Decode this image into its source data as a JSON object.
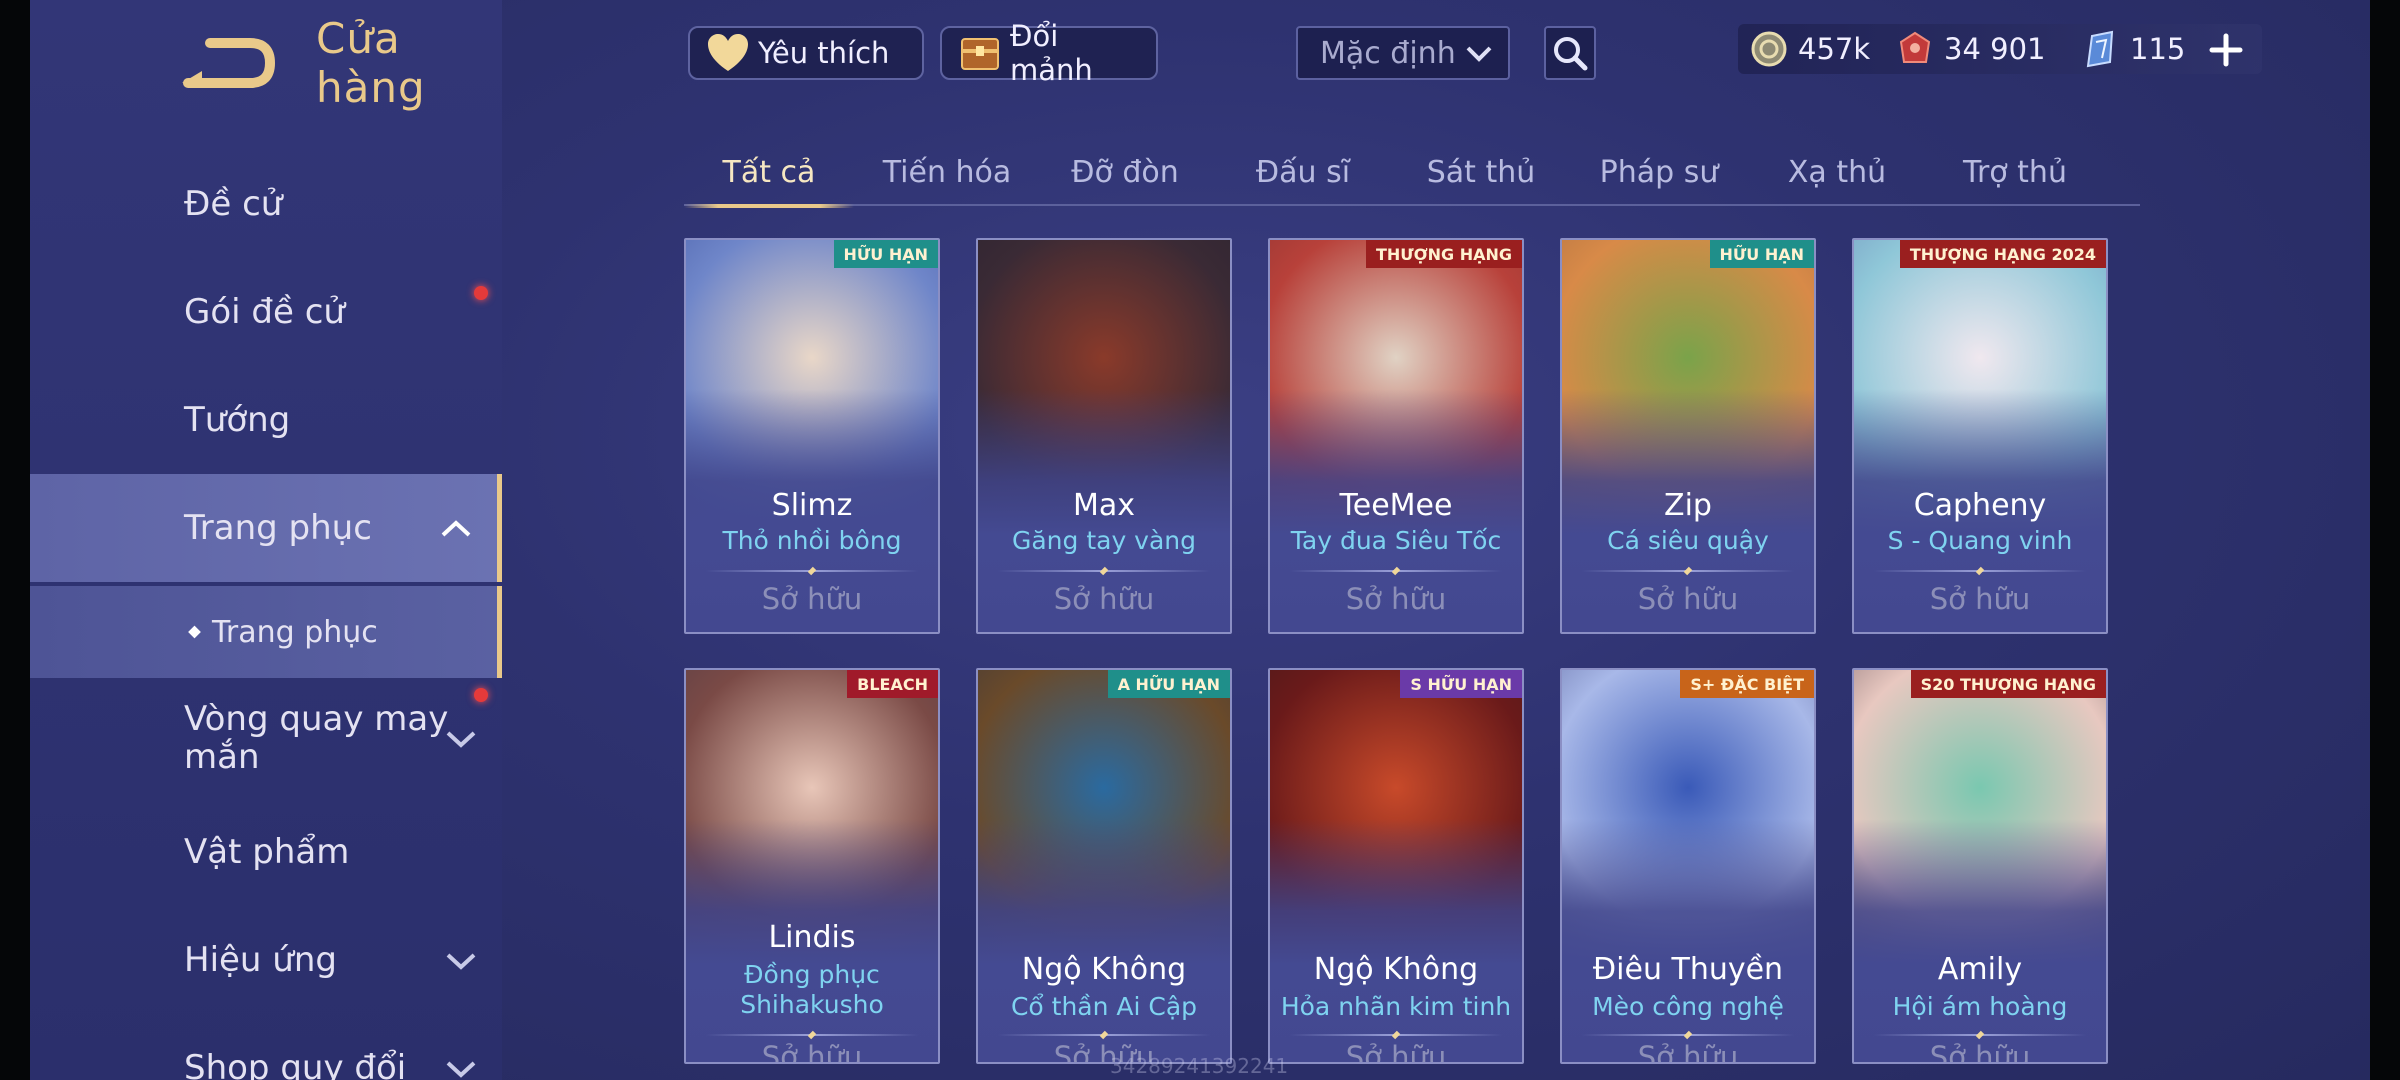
{
  "header": {
    "title": "Cửa hàng"
  },
  "sidebar": {
    "items": [
      {
        "label": "Đề cử",
        "badge": false,
        "chevron": ""
      },
      {
        "label": "Gói đề cử",
        "badge": true,
        "chevron": ""
      },
      {
        "label": "Tướng",
        "badge": false,
        "chevron": ""
      },
      {
        "label": "Trang phục",
        "badge": false,
        "chevron": "up",
        "active": true
      },
      {
        "label": "Trang phục",
        "sub": true
      },
      {
        "label": "Vòng quay may mắn",
        "badge": true,
        "chevron": "down"
      },
      {
        "label": "Vật phẩm",
        "badge": false,
        "chevron": ""
      },
      {
        "label": "Hiệu ứng",
        "badge": false,
        "chevron": "down"
      },
      {
        "label": "Shop quy đổi",
        "badge": false,
        "chevron": "down"
      }
    ]
  },
  "topbar": {
    "favorite_label": "Yêu thích",
    "exchange_label": "Đổi mảnh",
    "sort_value": "Mặc định",
    "currencies": [
      {
        "icon": "gold-coin-icon",
        "value": "457k"
      },
      {
        "icon": "red-voucher-icon",
        "value": "34 901"
      },
      {
        "icon": "blue-crystal-icon",
        "value": "115"
      }
    ]
  },
  "tabs": [
    "Tất cả",
    "Tiến hóa",
    "Đỡ đòn",
    "Đấu sĩ",
    "Sát thủ",
    "Pháp sư",
    "Xạ thủ",
    "Trợ thủ"
  ],
  "cards": [
    {
      "hero": "Slimz",
      "skin": "Thỏ nhồi bông",
      "status": "Sở hữu",
      "badge": "HỮU HẠN",
      "badge_color": "#1f8f8a",
      "art": [
        "#e9d7c8",
        "#6f86c9",
        "#2a3f8f"
      ]
    },
    {
      "hero": "Max",
      "skin": "Găng tay vàng",
      "status": "Sở hữu",
      "badge": "",
      "badge_color": "",
      "art": [
        "#8a3a2a",
        "#3a2a35",
        "#1f1d2a"
      ]
    },
    {
      "hero": "TeeMee",
      "skin": "Tay đua Siêu Tốc",
      "status": "Sở hữu",
      "badge": "THƯỢNG HẠNG",
      "badge_color": "#9a1f1f",
      "art": [
        "#e0d2c4",
        "#b8413a",
        "#6a2a2a"
      ]
    },
    {
      "hero": "Zip",
      "skin": "Cá siêu quậy",
      "status": "Sở hữu",
      "badge": "HỮU HẠN",
      "badge_color": "#1f8f8a",
      "art": [
        "#7aa34a",
        "#d88a48",
        "#8a5a3a"
      ]
    },
    {
      "hero": "Capheny",
      "skin": "S - Quang vinh",
      "status": "Sở hữu",
      "badge": "THƯỢNG HẠNG 2024",
      "badge_color": "#9a1f1f",
      "art": [
        "#f0e8ef",
        "#8fc7d8",
        "#5a6aa8"
      ]
    },
    {
      "hero": "Lindis",
      "skin": "Đồng phục Shihakusho",
      "status": "Sở hữu",
      "badge": "BLEACH",
      "badge_color": "#a01a2a",
      "art": [
        "#e8c6b8",
        "#7a4a46",
        "#3a3348"
      ]
    },
    {
      "hero": "Ngộ Không",
      "skin": "Cổ thần Ai Cập",
      "status": "Sở hữu",
      "badge": "A HỮU HẠN",
      "badge_color": "#1f8f8a",
      "art": [
        "#2a6aa0",
        "#6a4a2a",
        "#1a2a4a"
      ]
    },
    {
      "hero": "Ngộ Không",
      "skin": "Hỏa nhãn kim tinh",
      "status": "Sở hữu",
      "badge": "S HỮU HẠN",
      "badge_color": "#6a3aa8",
      "art": [
        "#c84a2a",
        "#6a1a1a",
        "#2a1a1a"
      ]
    },
    {
      "hero": "Điêu Thuyền",
      "skin": "Mèo công nghệ",
      "status": "Sở hữu",
      "badge": "S+ ĐẶC BIỆT",
      "badge_color": "#c8641a",
      "art": [
        "#3a5ab8",
        "#a8b8e8",
        "#2a2f6a"
      ]
    },
    {
      "hero": "Amily",
      "skin": "Hội ám hoàng",
      "status": "Sở hữu",
      "badge": "S20 THƯỢNG HẠNG",
      "badge_color": "#9a1f1f",
      "art": [
        "#7ac8b0",
        "#e8c8c0",
        "#2a1a2a"
      ]
    }
  ],
  "watermark": "34289241392241",
  "colors": {
    "accent_gold": "#e9c98a",
    "skin_name": "#7fd3f0",
    "owned": "#8c8fb8",
    "badge_red": "#e53a3a"
  }
}
